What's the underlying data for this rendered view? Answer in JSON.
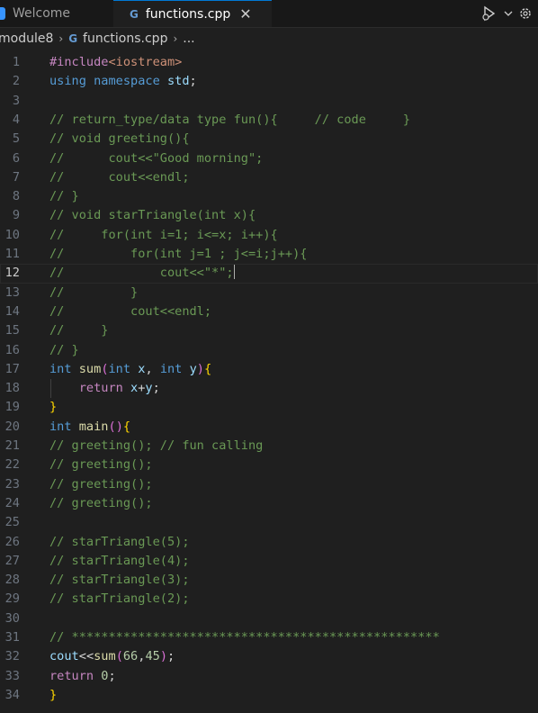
{
  "tabs": [
    {
      "label": "Welcome",
      "active": false
    },
    {
      "label": "functions.cpp",
      "active": true
    }
  ],
  "breadcrumb": {
    "folder": "module8",
    "file": "functions.cpp",
    "more": "..."
  },
  "icons": {
    "cpp": "G",
    "close": "✕",
    "chevron": "›"
  },
  "editor": {
    "current_line": 12,
    "lines": [
      {
        "n": "1",
        "text": "#include<iostream>"
      },
      {
        "n": "2",
        "text": "using namespace std;"
      },
      {
        "n": "3",
        "text": ""
      },
      {
        "n": "4",
        "text": "// return_type/data type fun(){     // code     }"
      },
      {
        "n": "5",
        "text": "// void greeting(){"
      },
      {
        "n": "6",
        "text": "//      cout<<\"Good morning\";"
      },
      {
        "n": "7",
        "text": "//      cout<<endl;"
      },
      {
        "n": "8",
        "text": "// }"
      },
      {
        "n": "9",
        "text": "// void starTriangle(int x){"
      },
      {
        "n": "10",
        "text": "//     for(int i=1; i<=x; i++){"
      },
      {
        "n": "11",
        "text": "//         for(int j=1 ; j<=i;j++){"
      },
      {
        "n": "12",
        "text": "//             cout<<\"*\";"
      },
      {
        "n": "13",
        "text": "//         }"
      },
      {
        "n": "14",
        "text": "//         cout<<endl;"
      },
      {
        "n": "15",
        "text": "//     }"
      },
      {
        "n": "16",
        "text": "// }"
      },
      {
        "n": "17",
        "text": "int sum(int x, int y){"
      },
      {
        "n": "18",
        "text": "    return x+y;"
      },
      {
        "n": "19",
        "text": "}"
      },
      {
        "n": "20",
        "text": "int main(){"
      },
      {
        "n": "21",
        "text": "// greeting(); // fun calling"
      },
      {
        "n": "22",
        "text": "// greeting();"
      },
      {
        "n": "23",
        "text": "// greeting();"
      },
      {
        "n": "24",
        "text": "// greeting();"
      },
      {
        "n": "25",
        "text": ""
      },
      {
        "n": "26",
        "text": "// starTriangle(5);"
      },
      {
        "n": "27",
        "text": "// starTriangle(4);"
      },
      {
        "n": "28",
        "text": "// starTriangle(3);"
      },
      {
        "n": "29",
        "text": "// starTriangle(2);"
      },
      {
        "n": "30",
        "text": ""
      },
      {
        "n": "31",
        "text": "// **************************************************"
      },
      {
        "n": "32",
        "text": "cout<<sum(66,45);"
      },
      {
        "n": "33",
        "text": "return 0;"
      },
      {
        "n": "34",
        "text": "}"
      }
    ]
  }
}
